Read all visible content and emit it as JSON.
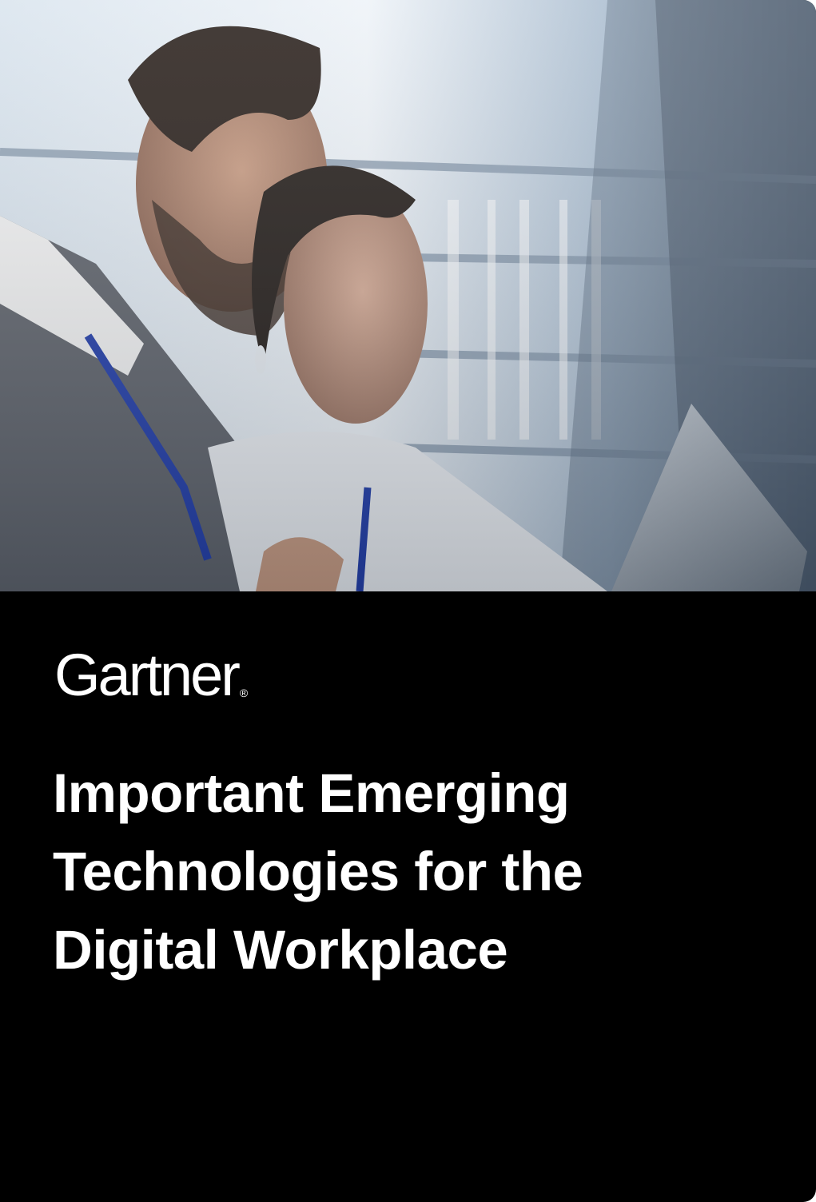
{
  "cover": {
    "photo": {
      "icon": "people-with-laptop-photo",
      "palette": {
        "highlight": "#eef3f8",
        "mid": "#9fb3c8",
        "shadow": "#2c3a4a",
        "skin": "#b98a72",
        "hair": "#1f1814",
        "lanyard": "#1e3aa8"
      }
    },
    "brand": {
      "name": "Gartner",
      "registered_mark": "®"
    },
    "title_lines": [
      "Important Emerging",
      "Technologies for the",
      "Digital Workplace"
    ],
    "colors": {
      "background": "#000000",
      "text": "#ffffff"
    }
  }
}
